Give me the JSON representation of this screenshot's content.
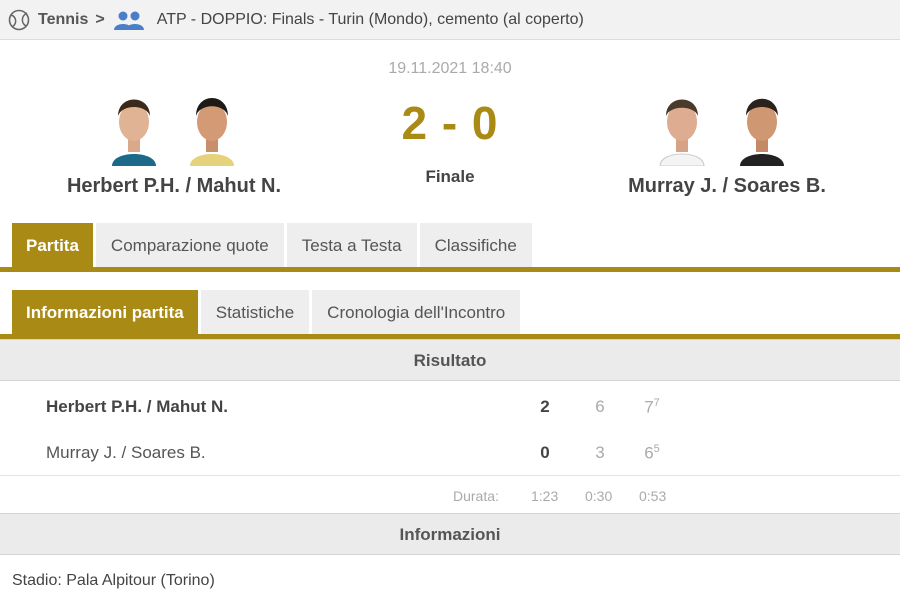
{
  "breadcrumb": {
    "sport": "Tennis",
    "tournament": "ATP - DOPPIO: Finals - Turin (Mondo), cemento (al coperto)"
  },
  "match": {
    "date": "19.11.2021 18:40",
    "score": "2 - 0",
    "status": "Finale",
    "home_team": "Herbert P.H. / Mahut N.",
    "away_team": "Murray J. / Soares B."
  },
  "main_tabs": [
    "Partita",
    "Comparazione quote",
    "Testa a Testa",
    "Classifiche"
  ],
  "sub_tabs": [
    "Informazioni partita",
    "Statistiche",
    "Cronologia dell'Incontro"
  ],
  "result": {
    "header": "Risultato",
    "rows": [
      {
        "name": "Herbert P.H. / Mahut N.",
        "sets_won": "2",
        "set1": "6",
        "set2": "7",
        "set2_tiebreak": "7"
      },
      {
        "name": "Murray J. / Soares B.",
        "sets_won": "0",
        "set1": "3",
        "set2": "6",
        "set2_tiebreak": "5"
      }
    ],
    "duration_label": "Durata:",
    "duration_total": "1:23",
    "duration_set1": "0:30",
    "duration_set2": "0:53"
  },
  "info": {
    "header": "Informazioni",
    "stadium": "Stadio: Pala Alpitour (Torino)"
  },
  "colors": {
    "accent": "#a98a15",
    "tab_bg": "#eeeeee",
    "header_bg": "#f2f2f2"
  },
  "icons": {
    "sport": "tennis-ball-icon",
    "category": "doubles-people-icon",
    "separator": "chevron-right-icon"
  }
}
